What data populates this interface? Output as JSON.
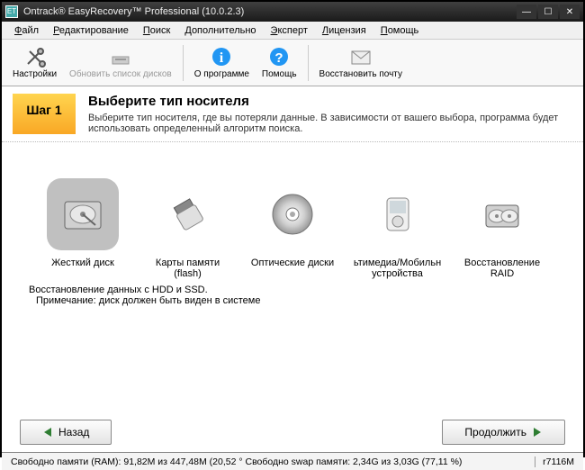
{
  "window": {
    "title": "Ontrack® EasyRecovery™ Professional (10.0.2.3)"
  },
  "menu": {
    "items": [
      "Файл",
      "Редактирование",
      "Поиск",
      "Дополнительно",
      "Эксперт",
      "Лицензия",
      "Помощь"
    ]
  },
  "toolbar": {
    "settings": "Настройки",
    "refresh": "Обновить список дисков",
    "about": "О программе",
    "help": "Помощь",
    "recover_mail": "Восстановить почту"
  },
  "step": {
    "badge": "Шаг 1",
    "title": "Выберите тип носителя",
    "subtitle": "Выберите тип носителя, где вы потеряли данные. В зависимости от вашего выбора, программа будет использовать определенный алгоритм поиска."
  },
  "storage": {
    "items": [
      {
        "label": "Жесткий диск"
      },
      {
        "label": "Карты памяти (flash)"
      },
      {
        "label": "Оптические диски"
      },
      {
        "label": "ьтимедиа/Мобильн устройства"
      },
      {
        "label": "Восстановление RAID"
      }
    ],
    "desc_line1": "Восстановление данных с HDD и SSD.",
    "desc_line2": "Примечание: диск должен быть виден в системе"
  },
  "nav": {
    "back": "Назад",
    "next": "Продолжить"
  },
  "status": {
    "left": "Свободно памяти (RAM): 91,82M из 447,48M (20,52 ° Свободно swap памяти: 2,34G из 3,03G (77,11 %)",
    "right": "r7116M"
  }
}
